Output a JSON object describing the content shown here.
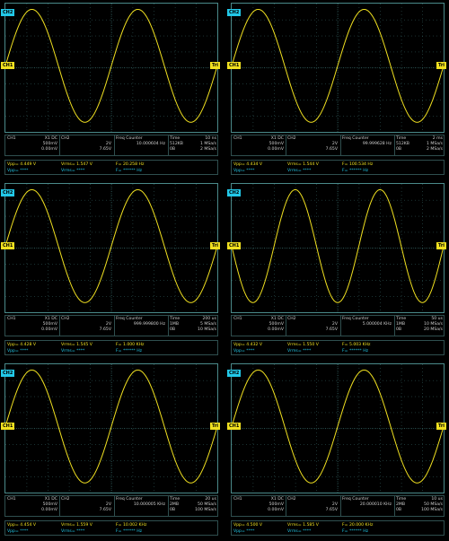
{
  "colors": {
    "ch1": "#f0e020",
    "ch2": "#22c8e8",
    "grid": "#4a8a8a"
  },
  "markers": {
    "ch2": "CH2",
    "ch1": "CH1",
    "trig": "Tri"
  },
  "panels": [
    {
      "ch1_name": "CH1",
      "ch1_coupling": "X1  DC",
      "ch1_scale": "500mV",
      "ch1_offset": "0.00mV",
      "ch2_name": "CH2",
      "ch2_scale": "2V",
      "ch2_offset": "7.65V",
      "fc_label": "Freq Counter",
      "fc_value": "10.000604 Hz",
      "time_label": "Time",
      "time_base": "10 ns",
      "mem": "512KB",
      "rate1": "1 MSa/s",
      "trig": "0B",
      "rate2": "2 MSa/s",
      "vpp": "Vpp= 4.449 V",
      "vrms": "Vrms= 1.547 V",
      "freq": "F= 20.258 Hz",
      "vpp2": "Vpp= ****",
      "vrms2": "Vrms= ****",
      "freq2": "F= ****** Hz",
      "cycles": 2,
      "phase": 0
    },
    {
      "ch1_name": "CH1",
      "ch1_coupling": "X1  DC",
      "ch1_scale": "500mV",
      "ch1_offset": "0.00mV",
      "ch2_name": "CH2",
      "ch2_scale": "2V",
      "ch2_offset": "7.65V",
      "fc_label": "Freq Counter",
      "fc_value": "99.999628 Hz",
      "time_label": "Time",
      "time_base": "2 ms",
      "mem": "512KB",
      "rate1": "1 MSa/s",
      "trig": "0B",
      "rate2": "2 MSa/s",
      "vpp": "Vpp= 4.434 V",
      "vrms": "Vrms= 1.544 V",
      "freq": "F= 100.534 Hz",
      "vpp2": "Vpp= ****",
      "vrms2": "Vrms= ****",
      "freq2": "F= ****** Hz",
      "cycles": 2,
      "phase": 0
    },
    {
      "ch1_name": "CH1",
      "ch1_coupling": "X1  DC",
      "ch1_scale": "500mV",
      "ch1_offset": "0.00mV",
      "ch2_name": "CH2",
      "ch2_scale": "2V",
      "ch2_offset": "7.65V",
      "fc_label": "Freq Counter",
      "fc_value": "999.999800 Hz",
      "time_label": "Time",
      "time_base": "200 us",
      "mem": "1MB",
      "rate1": "5 MSa/s",
      "trig": "0B",
      "rate2": "10 MSa/s",
      "vpp": "Vpp= 4.428 V",
      "vrms": "Vrms= 1.545 V",
      "freq": "F= 1.000 KHz",
      "vpp2": "Vpp= ****",
      "vrms2": "Vrms= ****",
      "freq2": "F= ****** Hz",
      "cycles": 2,
      "phase": 0
    },
    {
      "ch1_name": "CH1",
      "ch1_coupling": "X1  DC",
      "ch1_scale": "500mV",
      "ch1_offset": "0.00mV",
      "ch2_name": "CH2",
      "ch2_scale": "2V",
      "ch2_offset": "7.65V",
      "fc_label": "Freq Counter",
      "fc_value": "5.000004 KHz",
      "time_label": "Time",
      "time_base": "50 us",
      "mem": "1MB",
      "rate1": "10 MSa/s",
      "trig": "0B",
      "rate2": "20 MSa/s",
      "vpp": "Vpp= 4.432 V",
      "vrms": "Vrms= 1.550 V",
      "freq": "F= 5.003 KHz",
      "vpp2": "Vpp= ****",
      "vrms2": "Vrms= ****",
      "freq2": "F= ****** Hz",
      "cycles": 2.5,
      "phase": 0.5
    },
    {
      "ch1_name": "CH1",
      "ch1_coupling": "X1  DC",
      "ch1_scale": "500mV",
      "ch1_offset": "0.00mV",
      "ch2_name": "CH2",
      "ch2_scale": "2V",
      "ch2_offset": "7.65V",
      "fc_label": "Freq Counter",
      "fc_value": "10.000005 KHz",
      "time_label": "Time",
      "time_base": "20 us",
      "mem": "2MB",
      "rate1": "50 MSa/s",
      "trig": "0B",
      "rate2": "100 MSa/s",
      "vpp": "Vpp= 4.454 V",
      "vrms": "Vrms= 1.559 V",
      "freq": "F= 10.002 KHz",
      "vpp2": "Vpp= ****",
      "vrms2": "Vrms= ****",
      "freq2": "F= ****** Hz",
      "cycles": 2,
      "phase": 0
    },
    {
      "ch1_name": "CH1",
      "ch1_coupling": "X1  DC",
      "ch1_scale": "500mV",
      "ch1_offset": "0.00mV",
      "ch2_name": "CH2",
      "ch2_scale": "2V",
      "ch2_offset": "7.65V",
      "fc_label": "Freq Counter",
      "fc_value": "20.000010 KHz",
      "time_label": "Time",
      "time_base": "10 us",
      "mem": "2MB",
      "rate1": "50 MSa/s",
      "trig": "0B",
      "rate2": "100 MSa/s",
      "vpp": "Vpp= 4.500 V",
      "vrms": "Vrms= 1.585 V",
      "freq": "F= 20.000 KHz",
      "vpp2": "Vpp= ****",
      "vrms2": "Vrms= ****",
      "freq2": "F= ****** Hz",
      "cycles": 2,
      "phase": 0
    }
  ]
}
